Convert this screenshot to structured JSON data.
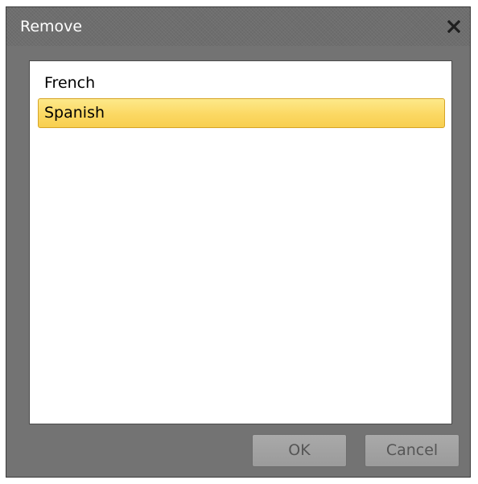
{
  "window": {
    "title": "Remove",
    "close_icon": "close-icon"
  },
  "list": {
    "items": [
      {
        "label": "French",
        "selected": false
      },
      {
        "label": "Spanish",
        "selected": true
      }
    ]
  },
  "buttons": {
    "ok_label": "OK",
    "cancel_label": "Cancel"
  },
  "colors": {
    "title_bar": "#6e6e6e",
    "selection_fill": "#fbd863",
    "selection_border": "#d6a426"
  }
}
